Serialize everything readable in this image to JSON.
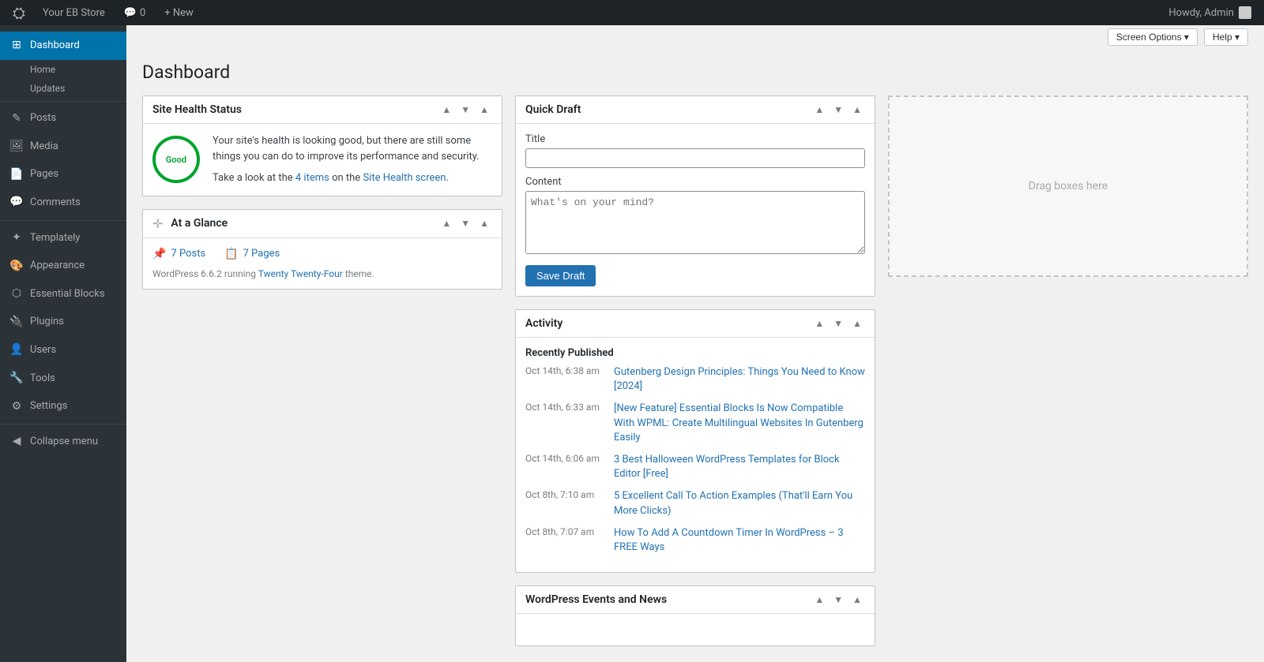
{
  "adminbar": {
    "logo": "⛭",
    "site_name": "Your EB Store",
    "comments_icon": "💬",
    "comments_count": "0",
    "new_label": "+ New",
    "howdy": "Howdy, Admin"
  },
  "screen_options": {
    "screen_options_label": "Screen Options ▾",
    "help_label": "Help ▾"
  },
  "sidebar": {
    "dashboard_label": "Dashboard",
    "home_label": "Home",
    "updates_label": "Updates",
    "posts_label": "Posts",
    "media_label": "Media",
    "pages_label": "Pages",
    "comments_label": "Comments",
    "templately_label": "Templately",
    "appearance_label": "Appearance",
    "essential_blocks_label": "Essential Blocks",
    "plugins_label": "Plugins",
    "users_label": "Users",
    "tools_label": "Tools",
    "settings_label": "Settings",
    "collapse_label": "Collapse menu"
  },
  "page": {
    "title": "Dashboard"
  },
  "site_health": {
    "title": "Site Health Status",
    "status": "Good",
    "description": "Your site's health is looking good, but there are still some things you can do to improve its performance and security.",
    "items_count": "4 items",
    "items_link_text": "4 items",
    "screen_link_text": "Site Health screen",
    "take_look": "Take a look at the",
    "on_the": "on the",
    "period": "."
  },
  "at_a_glance": {
    "title": "At a Glance",
    "posts_count": "7 Posts",
    "pages_count": "7 Pages",
    "wp_info": "WordPress 6.6.2 running",
    "theme_link": "Twenty Twenty-Four",
    "theme_suffix": "theme."
  },
  "quick_draft": {
    "title": "Quick Draft",
    "title_label": "Title",
    "title_placeholder": "",
    "content_label": "Content",
    "content_placeholder": "What's on your mind?",
    "save_btn": "Save Draft"
  },
  "activity": {
    "title": "Activity",
    "recently_published": "Recently Published",
    "items": [
      {
        "date": "Oct 14th, 6:38 am",
        "text": "Gutenberg Design Principles: Things You Need to Know [2024]"
      },
      {
        "date": "Oct 14th, 6:33 am",
        "text": "[New Feature] Essential Blocks Is Now Compatible With WPML: Create Multilingual Websites In Gutenberg Easily"
      },
      {
        "date": "Oct 14th, 6:06 am",
        "text": "3 Best Halloween WordPress Templates for Block Editor [Free]"
      },
      {
        "date": "Oct 8th, 7:10 am",
        "text": "5 Excellent Call To Action Examples (That'll Earn You More Clicks)"
      },
      {
        "date": "Oct 8th, 7:07 am",
        "text": "How To Add A Countdown Timer In WordPress – 3 FREE Ways"
      }
    ]
  },
  "drag_box": {
    "label": "Drag boxes here"
  },
  "events": {
    "title": "WordPress Events and News"
  }
}
